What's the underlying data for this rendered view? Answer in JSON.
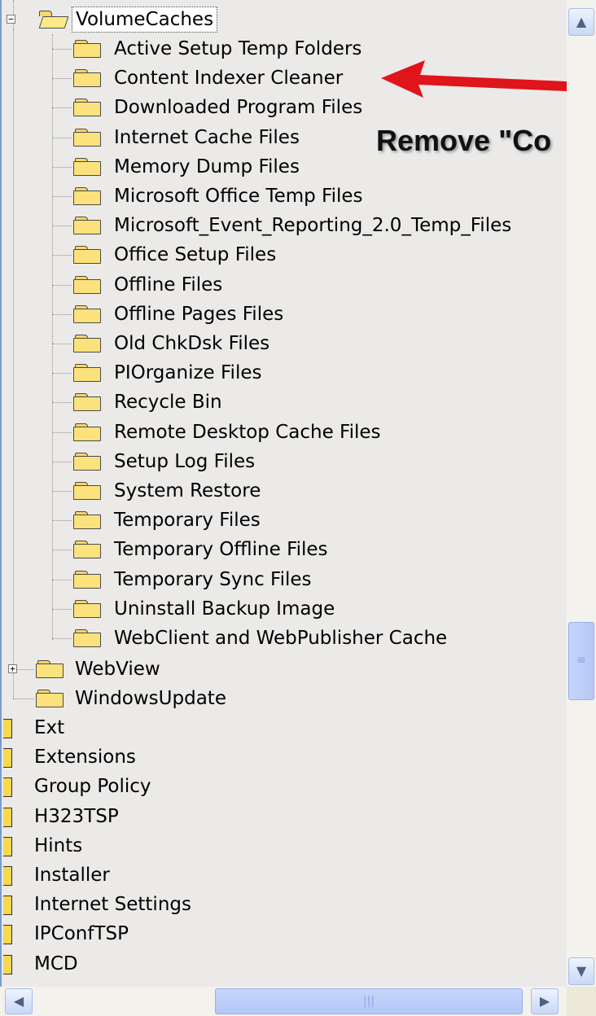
{
  "tree": {
    "parent": {
      "label": "VolumeCaches",
      "expanded": true,
      "selected": true
    },
    "volume_caches_children": [
      "Active Setup Temp Folders",
      "Content Indexer Cleaner",
      "Downloaded Program Files",
      "Internet Cache Files",
      "Memory Dump Files",
      "Microsoft Office Temp Files",
      "Microsoft_Event_Reporting_2.0_Temp_Files",
      "Office Setup Files",
      "Offline Files",
      "Offline Pages Files",
      "Old ChkDsk Files",
      "PIOrganize Files",
      "Recycle Bin",
      "Remote Desktop Cache Files",
      "Setup Log Files",
      "System Restore",
      "Temporary Files",
      "Temporary Offline Files",
      "Temporary Sync Files",
      "Uninstall Backup Image",
      "WebClient and WebPublisher Cache"
    ],
    "siblings": [
      {
        "label": "WebView",
        "expandable": true
      },
      {
        "label": "WindowsUpdate",
        "expandable": false
      }
    ],
    "top_level": [
      "Ext",
      "Extensions",
      "Group Policy",
      "H323TSP",
      "Hints",
      "Installer",
      "Internet Settings",
      "IPConfTSP",
      "MCD"
    ]
  },
  "annotation": {
    "text": "Remove \"Co",
    "arrow_color": "#e0141b"
  },
  "icons": {
    "folder": "folder-icon",
    "open_folder": "open-folder-icon",
    "scroll_up": "chevron-up-icon",
    "scroll_down": "chevron-down-icon",
    "scroll_left": "chevron-left-icon",
    "scroll_right": "chevron-right-icon",
    "expander_collapse": "minus-icon",
    "expander_expand": "plus-icon"
  },
  "colors": {
    "tree_background": "#ebeae8",
    "folder_fill": "#fbe27d",
    "scrollbar_thumb": "#c6d5fb"
  }
}
